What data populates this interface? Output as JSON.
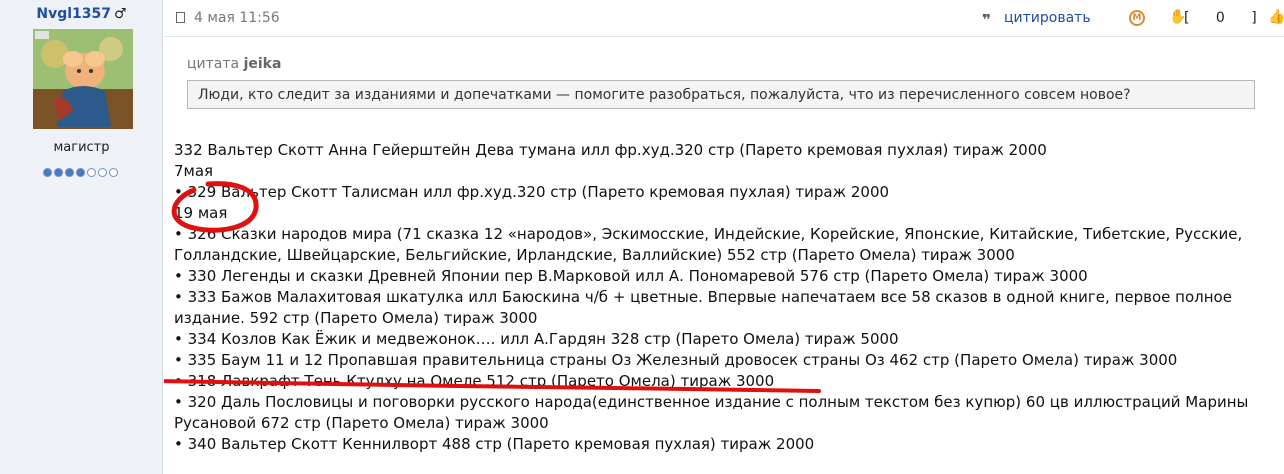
{
  "user": {
    "name": "Nvgl1357",
    "sex_symbol": "♂",
    "rank": "магистр",
    "rating_dots": {
      "filled": 4,
      "total": 7
    }
  },
  "post": {
    "date": "4 мая 11:56",
    "quote_action": "цитировать",
    "rating_open": "[",
    "rating_value": "0",
    "rating_close": "]",
    "quote_label": "цитата",
    "quote_author": "jeika",
    "quote_text": "Люди, кто следит за изданиями и допечатками — помогите разобраться, пожалуйста, что из перечисленного совсем новое?",
    "lines": [
      "332 Вальтер Скотт Анна Гейерштейн Дева тумана илл фр.худ.320 стр (Парето кремовая пухлая) тираж 2000",
      "7мая",
      "• 329 Вальтер Скотт Талисман илл фр.худ.320 стр (Парето кремовая пухлая) тираж 2000",
      "19 мая",
      "• 326 Сказки народов мира (71 сказка 12 «народов», Эскимосские, Индейские, Корейские, Японские, Китайские, Тибетские, Русские,",
      "Голландские, Швейцарские, Бельгийские, Ирландские, Валлийские) 552 стр (Парето Омела) тираж 3000",
      "• 330 Легенды и сказки Древней Японии пер В.Марковой илл А. Пономаревой 576 стр (Парето Омела) тираж 3000",
      "• 333 Бажов Малахитовая шкатулка илл Баюскина ч/б + цветные. Впервые напечатаем все 58 сказов в одной книге, первое полное",
      "издание. 592 стр (Парето Омела) тираж 3000",
      "• 334 Козлов Как Ёжик и медвежонок…. илл А.Гардян 328 стр (Парето Омела) тираж 5000",
      "• 335 Баум 11 и 12 Пропавшая правительница страны Оз Железный дровосек страны Оз 462 стр (Парето Омела) тираж 3000",
      "• 318 Лавкрафт Тень Ктулху на Омеле 512 стр (Парето Омела) тираж 3000",
      "• 320 Даль Пословицы и поговорки русского народа(единственное издание с полным текстом без купюр) 60 цв иллюстраций Марины",
      "Русановой 672 стр (Парето Омела) тираж 3000",
      "• 340 Вальтер Скотт Кеннилворт 488 стр (Парето кремовая пухлая) тираж 2000"
    ]
  },
  "icons": {
    "post": "post-icon",
    "quote": "quote-icon",
    "moderator": "moderator-icon",
    "vote_down": "thumbs-down-icon",
    "vote_up": "thumbs-up-icon"
  },
  "colors": {
    "username": "#1f4fa0",
    "link": "#1f4fa0",
    "annotation": "#e01010",
    "vote_down": "#e08a30",
    "vote_up": "#3aa33a"
  }
}
